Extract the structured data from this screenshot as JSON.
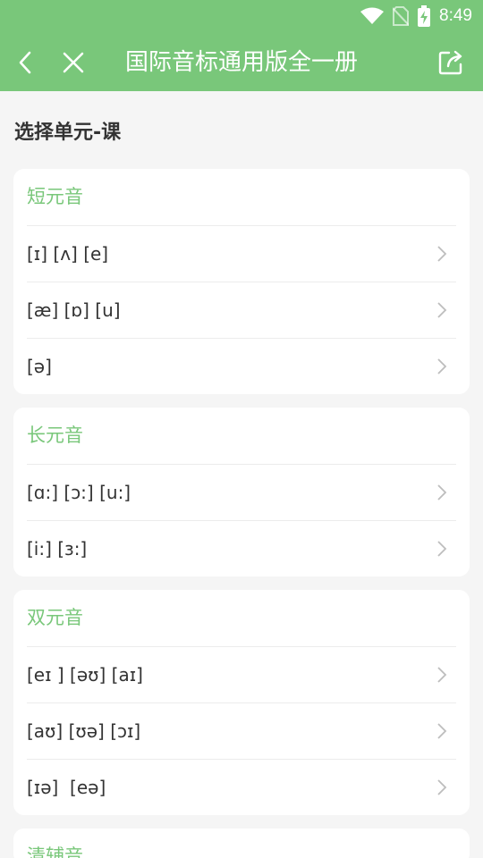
{
  "status_bar": {
    "time": "8:49"
  },
  "toolbar": {
    "title": "国际音标通用版全一册"
  },
  "main": {
    "heading": "选择单元-课",
    "sections": [
      {
        "title": "短元音",
        "items": [
          "[ɪ] [ʌ] [e]",
          "[æ] [ɒ] [u]",
          "[ə]"
        ]
      },
      {
        "title": "长元音",
        "items": [
          "[ɑ:] [ɔ:] [u:]",
          "[i:] [ɜ:]"
        ]
      },
      {
        "title": "双元音",
        "items": [
          "[eɪ ] [əʊ] [aɪ]",
          "[aʊ] [ʊə] [ɔɪ]",
          "[ɪə]  [eə]"
        ]
      },
      {
        "title": "清辅音",
        "items": []
      }
    ]
  },
  "colors": {
    "accent": "#79c77a",
    "background": "#f5f5f5"
  }
}
